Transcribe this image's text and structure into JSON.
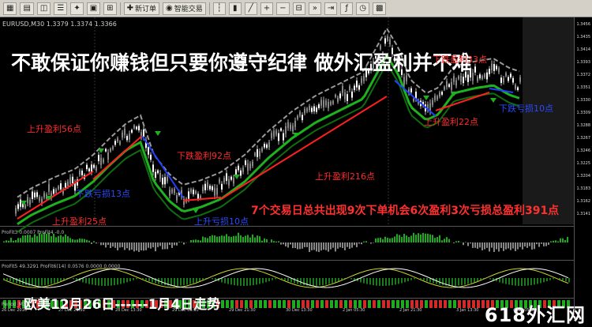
{
  "toolbar": {
    "new_order_label": "新订单",
    "auto_trading_label": "智能交易"
  },
  "chart": {
    "symbol_label": "EURUSD,M30 1.3379 1.3374 1.3366",
    "headline": "不敢保证你赚钱但只要你遵守纪律 做外汇盈利并不难",
    "summary": "7个交易日总共出现9次下单机会6次盈利3次亏损总盈利391点",
    "bottom_title": "欧美12月26日------1月4日走势",
    "watermark": "618外汇网",
    "indicator1_label": "ProFit3 0.0007 ProFit4 -0.0",
    "indicator2_label": "ProFit5 49.3291 ProFit6(14) 0.0576 0.0000 0.0000",
    "indicator3_label": "Period_M30",
    "colors": {
      "up": "#ff2020",
      "down": "#2040ff",
      "trend": "#1fb21f",
      "wick": "#bdbdbd"
    }
  },
  "annotations": {
    "up56": "上升盈利56点",
    "down92": "下跌盈利92点",
    "down_loss13": "下跌亏损13点",
    "up25": "上升盈利25点",
    "up_loss10": "上升亏损10点",
    "up216": "上升盈利216点",
    "down33": "下跌盈利33点",
    "up22": "上升盈利22点",
    "down_loss10": "下跌亏损10点"
  },
  "price_axis": [
    "1.3456",
    "1.3435",
    "1.3414",
    "1.3393",
    "1.3372",
    "1.3351",
    "1.3330",
    "1.3309",
    "1.3288",
    "1.3267",
    "1.3246",
    "1.3225",
    "1.3204",
    "1.3183",
    "1.3162",
    "1.3141"
  ],
  "time_axis": [
    "26 Dec 2016",
    "27 Dec 21:30",
    "28 Dec 13:30",
    "29 Dec 05:30",
    "29 Dec 21:30",
    "30 Dec 13:30",
    "2 Jan 05:30",
    "2 Jan 21:30",
    "3 Jan 13:30",
    "4 Jan 05:30"
  ]
}
